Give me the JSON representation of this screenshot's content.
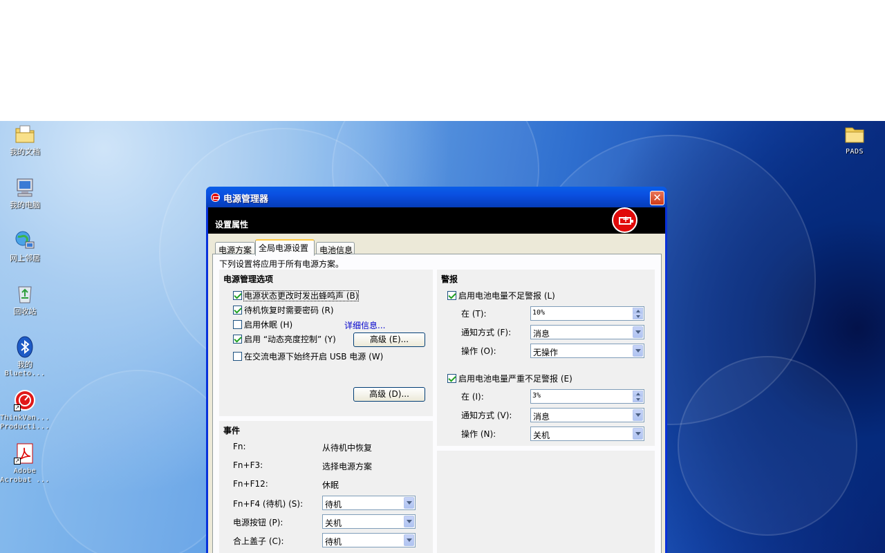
{
  "desktop": {
    "icons": [
      {
        "label": "我的文档",
        "icon": "my-documents-icon"
      },
      {
        "label": "我的电脑",
        "icon": "my-computer-icon"
      },
      {
        "label": "网上邻居",
        "icon": "network-places-icon"
      },
      {
        "label": "回收站",
        "icon": "recycle-bin-icon"
      },
      {
        "label1": "我的",
        "label2": "Blueto...",
        "icon": "bluetooth-icon"
      },
      {
        "label1": "ThinkVan...",
        "label2": "Producti...",
        "icon": "thinkvantage-icon"
      },
      {
        "label1": "Adobe",
        "label2": "Acrobat ...",
        "icon": "adobe-acrobat-icon"
      }
    ],
    "right_icon": {
      "label": "PADS",
      "icon": "folder-icon"
    }
  },
  "window": {
    "title": "电源管理器",
    "banner_title": "设置属性",
    "tabs": [
      "电源方案",
      "全局电源设置",
      "电池信息"
    ],
    "active_tab": "全局电源设置",
    "intro": "下列设置将应用于所有电源方案。",
    "options": {
      "title": "电源管理选项",
      "checks": [
        {
          "label": "电源状态更改时发出蜂鸣声 (B)",
          "checked": true
        },
        {
          "label": "待机恢复时需要密码 (R)",
          "checked": true
        },
        {
          "label": "启用休眠 (H)",
          "checked": false
        },
        {
          "label": "启用 “动态亮度控制” (Y)",
          "checked": true
        },
        {
          "label": "在交流电源下始终开启 USB 电源 (W)",
          "checked": false
        }
      ],
      "details_link": "详细信息...",
      "advanced_e": "高级 (E)...",
      "advanced_d": "高级 (D)..."
    },
    "events": {
      "title": "事件",
      "rows": [
        {
          "key": "Fn:",
          "value": "从待机中恢复"
        },
        {
          "key": "Fn+F3:",
          "value": "选择电源方案"
        },
        {
          "key": "Fn+F12:",
          "value": "休眠"
        }
      ],
      "selects": [
        {
          "label": "Fn+F4 (待机) (S):",
          "value": "待机"
        },
        {
          "label": "电源按钮 (P):",
          "value": "关机"
        },
        {
          "label": "合上盖子 (C):",
          "value": "待机"
        }
      ]
    },
    "alarms": {
      "title": "警报",
      "low": {
        "label": "启用电池电量不足警报 (L)",
        "checked": true,
        "at_label": "在 (T):",
        "at_value": "10%",
        "notify_label": "通知方式 (F):",
        "notify_value": "消息",
        "action_label": "操作 (O):",
        "action_value": "无操作"
      },
      "critical": {
        "label": "启用电池电量严重不足警报 (E)",
        "checked": true,
        "at_label": "在 (I):",
        "at_value": "3%",
        "notify_label": "通知方式 (V):",
        "notify_value": "消息",
        "action_label": "操作 (N):",
        "action_value": "关机"
      }
    }
  }
}
